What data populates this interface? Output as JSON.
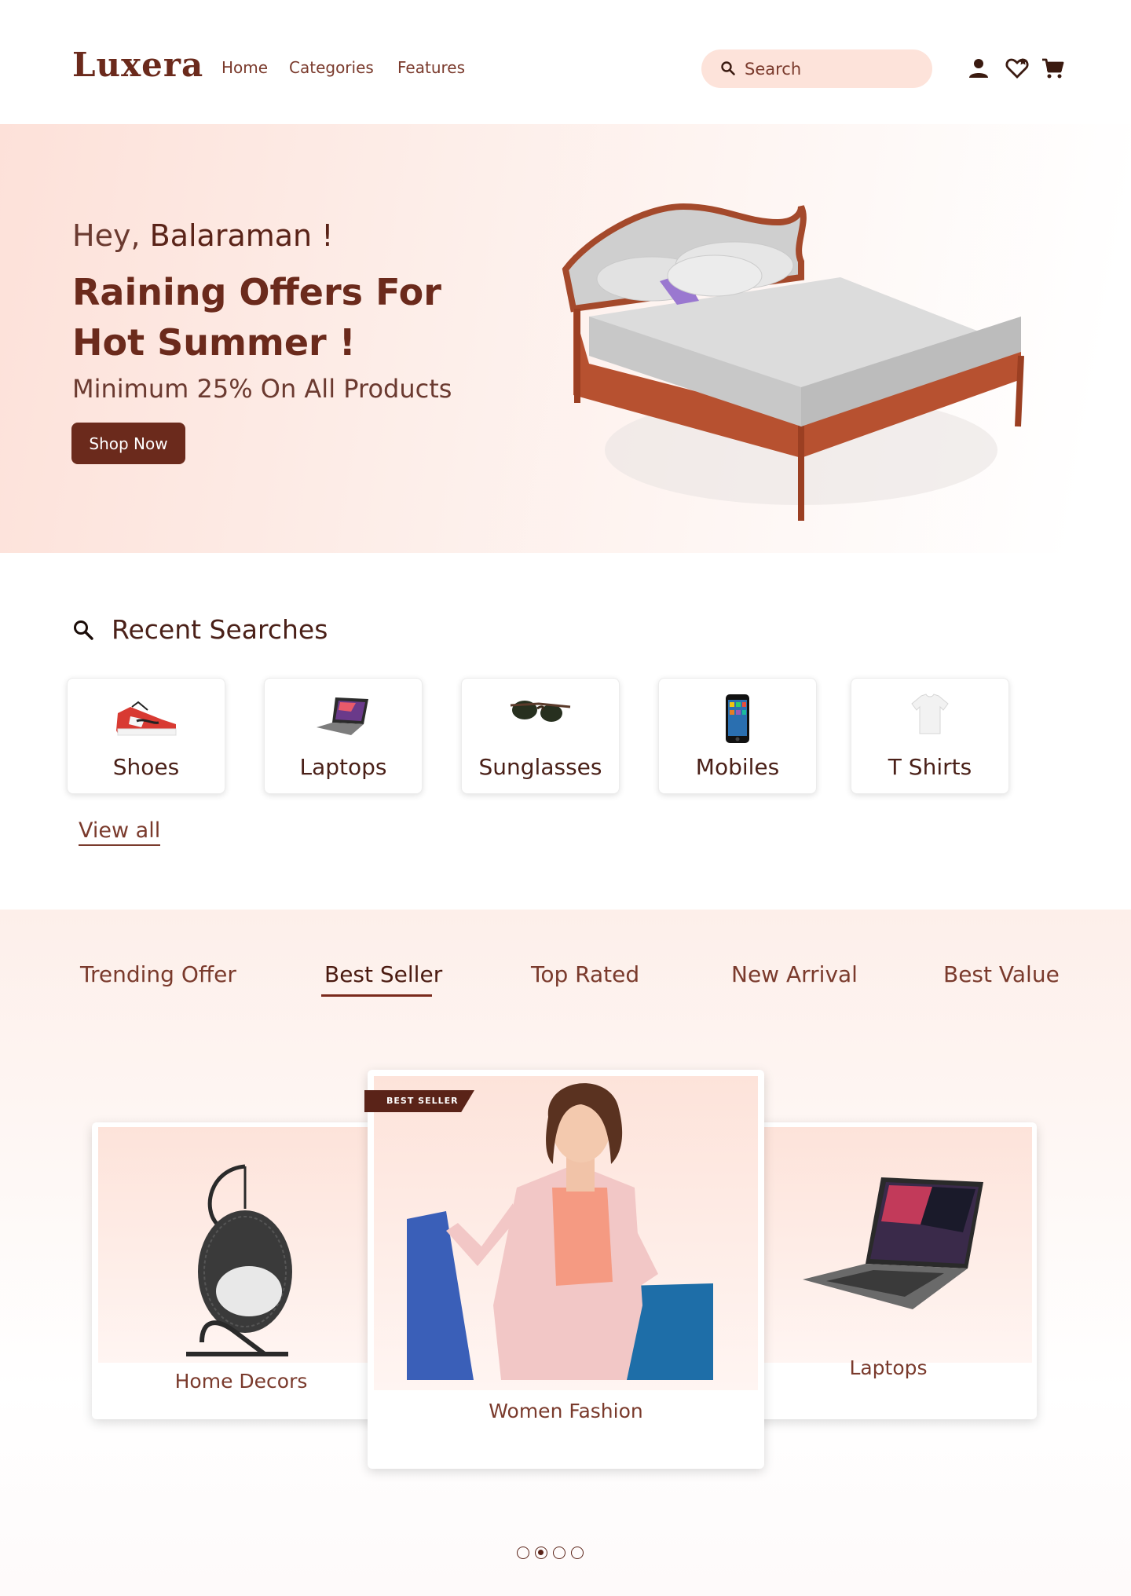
{
  "brand": {
    "logo": "Luxera"
  },
  "nav": {
    "items": [
      "Home",
      "Categories",
      "Features"
    ]
  },
  "search": {
    "placeholder": "Search"
  },
  "header_icons": [
    "user-icon",
    "heart-icon",
    "cart-icon"
  ],
  "hero": {
    "greeting_prefix": "Hey,",
    "greeting_name": "Balaraman !",
    "title": "Raining Offers For Hot Summer !",
    "subtitle": "Minimum 25% On All Products",
    "cta": "Shop Now"
  },
  "recent": {
    "title": "Recent Searches",
    "items": [
      "Shoes",
      "Laptops",
      "Sunglasses",
      "Mobiles",
      "T Shirts"
    ],
    "view_all": "View all"
  },
  "tabs": {
    "items": [
      "Trending Offer",
      "Best Seller",
      "Top Rated",
      "New Arrival",
      "Best Value"
    ],
    "active": "Best Seller"
  },
  "carousel": {
    "badge": "BEST SELLER",
    "cards": [
      "Home Decors",
      "Women Fashion",
      "Laptops"
    ],
    "dots_total": 4,
    "dots_active_index": 1
  },
  "colors": {
    "brand": "#6b2a1c",
    "search_bg": "#fde3da",
    "hero_bg": "#fde1d9"
  }
}
